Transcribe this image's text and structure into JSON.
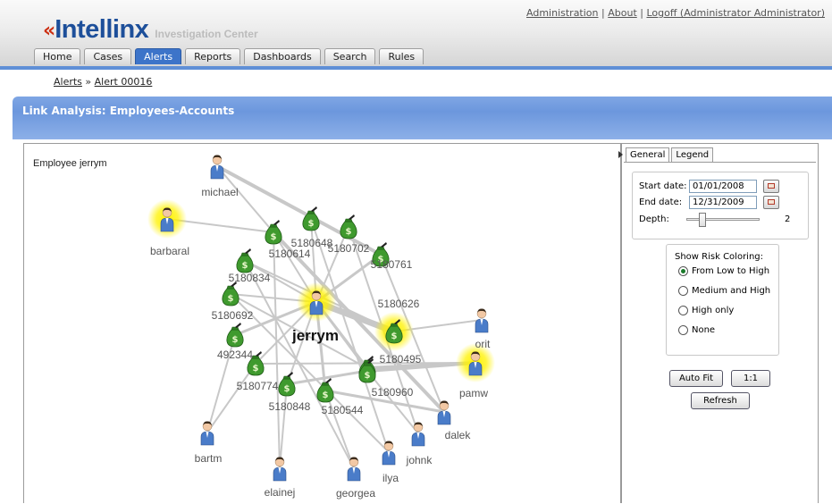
{
  "app": {
    "logo_mark": "«",
    "logo_name": "Intellinx",
    "logo_subtitle": "Investigation Center"
  },
  "top_links": {
    "administration": "Administration",
    "about": "About",
    "logoff": "Logoff (Administrator Administrator)",
    "separator": "|"
  },
  "nav_tabs": [
    {
      "label": "Home",
      "active": false
    },
    {
      "label": "Cases",
      "active": false
    },
    {
      "label": "Alerts",
      "active": true
    },
    {
      "label": "Reports",
      "active": false
    },
    {
      "label": "Dashboards",
      "active": false
    },
    {
      "label": "Search",
      "active": false
    },
    {
      "label": "Rules",
      "active": false
    }
  ],
  "breadcrumb": {
    "alerts": "Alerts",
    "separator": "»",
    "current": "Alert 00016"
  },
  "page_title": "Link Analysis: Employees-Accounts",
  "graph": {
    "caption": "Employee jerrym",
    "center": "jerrym",
    "employees": [
      "michael",
      "barbaral",
      "orit",
      "pamw",
      "dalek",
      "johnk",
      "ilya",
      "georgea",
      "elainej",
      "bartm"
    ],
    "highlighted_employees": [
      "barbaral",
      "pamw"
    ],
    "accounts": [
      "5180648",
      "5180702",
      "5180614",
      "5180761",
      "5180834",
      "5180626",
      "5180692",
      "492344",
      "5180495",
      "5180774",
      "5180960",
      "5180848",
      "5180544"
    ],
    "highlighted_accounts": [
      "5180626"
    ],
    "icons": {
      "employee": "person-icon",
      "account": "money-bag-icon"
    },
    "colors": {
      "highlight": "#fff200",
      "money": "#3f9a2e",
      "person_shirt": "#4a7cc9",
      "edge": "#c8c8c8"
    }
  },
  "side_panel": {
    "tabs": [
      {
        "label": "General",
        "active": true
      },
      {
        "label": "Legend",
        "active": false
      }
    ],
    "start_date_label": "Start date:",
    "start_date": "01/01/2008",
    "end_date_label": "End date:",
    "end_date": "12/31/2009",
    "depth_label": "Depth:",
    "depth": "2",
    "risk_title": "Show Risk Coloring:",
    "risk_options": [
      {
        "label": "From Low to High",
        "checked": true
      },
      {
        "label": "Medium and High",
        "checked": false
      },
      {
        "label": "High only",
        "checked": false
      },
      {
        "label": "None",
        "checked": false
      }
    ],
    "auto_fit": "Auto Fit",
    "one_to_one": "1:1",
    "refresh": "Refresh"
  }
}
